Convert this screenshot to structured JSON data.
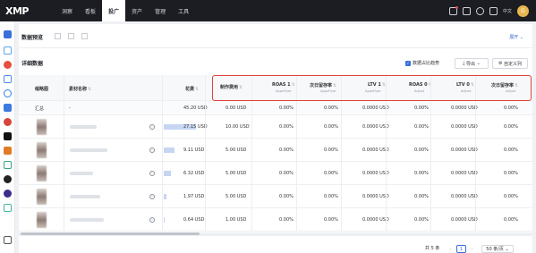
{
  "app": {
    "logo": "XMP"
  },
  "nav": [
    {
      "label": "洞察",
      "active": false
    },
    {
      "label": "看板",
      "active": false
    },
    {
      "label": "投广",
      "active": true
    },
    {
      "label": "资产",
      "active": false
    },
    {
      "label": "管理",
      "active": false
    },
    {
      "label": "工具",
      "active": false
    }
  ],
  "topbar": {
    "lang": "中文",
    "avatar": "G"
  },
  "panel": {
    "title": "数据预览",
    "expand_label": "展开",
    "section_title": "详细数据",
    "ratio_checkbox_label": "数据占比趋势",
    "export_label": "导出",
    "custom_columns_label": "自定义列"
  },
  "table": {
    "headers": [
      {
        "label": "缩略图",
        "sub": ""
      },
      {
        "label": "素材名称",
        "sub": ""
      },
      {
        "label": "花费",
        "sub": ""
      },
      {
        "label": "制作费用",
        "sub": ""
      },
      {
        "label": "ROAS 1",
        "sub": "AppsFlyer"
      },
      {
        "label": "次日留存率",
        "sub": "AppsFlyer"
      },
      {
        "label": "LTV 1",
        "sub": "AppsFlyer"
      },
      {
        "label": "ROAS 0",
        "sub": "Adjust"
      },
      {
        "label": "LTV 0",
        "sub": "Adjust"
      },
      {
        "label": "次日留存率",
        "sub": "Adjust"
      }
    ],
    "summary": {
      "label": "汇总",
      "name": "-",
      "cells": [
        "45.20 USD",
        "0.00 USD",
        "0.00%",
        "0.00%",
        "0.0000 USD",
        "0.00%",
        "0.0000 USD",
        "0.00%"
      ]
    },
    "rows": [
      {
        "spend_fraction": 1.0,
        "cells": [
          "27.15 USD",
          "10.00 USD",
          "0.00%",
          "0.00%",
          "0.0000 USD",
          "0.00%",
          "0.0000 USD",
          "0.00%"
        ]
      },
      {
        "spend_fraction": 0.34,
        "cells": [
          "9.11 USD",
          "5.00 USD",
          "0.00%",
          "0.00%",
          "0.0000 USD",
          "0.00%",
          "0.0000 USD",
          "0.00%"
        ]
      },
      {
        "spend_fraction": 0.23,
        "cells": [
          "6.32 USD",
          "5.00 USD",
          "0.00%",
          "0.00%",
          "0.0000 USD",
          "0.00%",
          "0.0000 USD",
          "0.00%"
        ]
      },
      {
        "spend_fraction": 0.07,
        "cells": [
          "1.97 USD",
          "5.00 USD",
          "0.00%",
          "0.00%",
          "0.0000 USD",
          "0.00%",
          "0.0000 USD",
          "0.00%"
        ]
      },
      {
        "spend_fraction": 0.02,
        "cells": [
          "0.64 USD",
          "1.00 USD",
          "0.00%",
          "0.00%",
          "0.0000 USD",
          "0.00%",
          "0.0000 USD",
          "0.00%"
        ]
      }
    ]
  },
  "pagination": {
    "total": "共 5 条",
    "page": "1",
    "page_size": "50 条/页"
  },
  "colors": {
    "accent": "#3b6fd8",
    "highlight_border": "#e0403a",
    "topbar": "#1c1d22"
  }
}
